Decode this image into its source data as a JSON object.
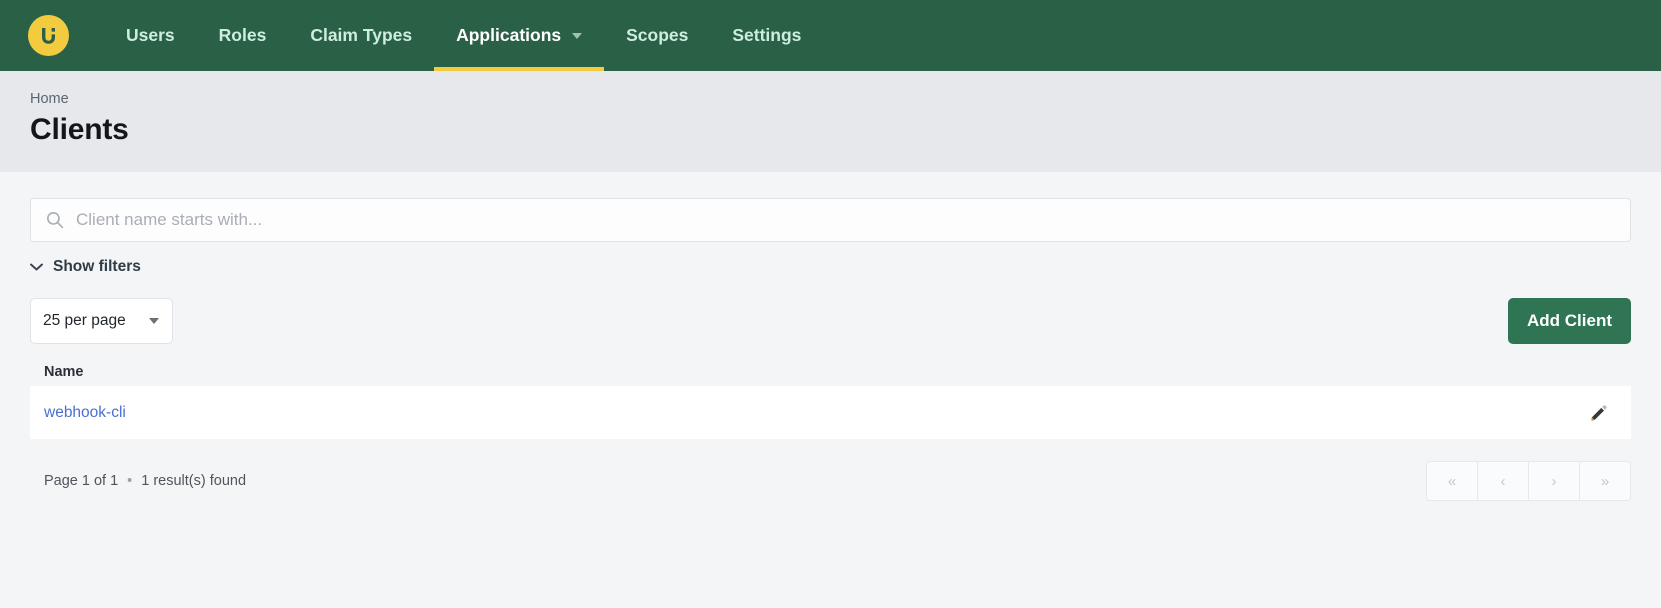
{
  "navbar": {
    "logo_icon": "ui-logo-icon",
    "logo_text": "Ui",
    "brand_color": "#f2cc3e",
    "bar_color": "#2a6046",
    "items": [
      {
        "label": "Users",
        "active": false,
        "has_caret": false
      },
      {
        "label": "Roles",
        "active": false,
        "has_caret": false
      },
      {
        "label": "Claim Types",
        "active": false,
        "has_caret": false
      },
      {
        "label": "Applications",
        "active": true,
        "has_caret": true
      },
      {
        "label": "Scopes",
        "active": false,
        "has_caret": false
      },
      {
        "label": "Settings",
        "active": false,
        "has_caret": false
      }
    ]
  },
  "page_head": {
    "breadcrumb": "Home",
    "title": "Clients"
  },
  "search": {
    "value": "",
    "placeholder": "Client name starts with...",
    "icon": "search-icon"
  },
  "filters": {
    "toggle_label": "Show filters",
    "icon": "chevron-down-icon"
  },
  "toolbar": {
    "per_page_value": "25 per page",
    "per_page_options": [
      "25 per page"
    ],
    "add_label": "Add Client",
    "add_color": "#2f7553"
  },
  "table": {
    "columns": [
      "Name"
    ],
    "rows": [
      {
        "name": "webhook-cli",
        "edit_icon": "pencil-icon"
      }
    ],
    "link_color": "#4a6fd4"
  },
  "footer": {
    "page_info": "Page 1 of 1",
    "separator": "•",
    "result_info": "1 result(s) found",
    "pager": [
      {
        "label": "«",
        "name": "first-page"
      },
      {
        "label": "‹",
        "name": "prev-page"
      },
      {
        "label": "›",
        "name": "next-page"
      },
      {
        "label": "»",
        "name": "last-page"
      }
    ]
  }
}
